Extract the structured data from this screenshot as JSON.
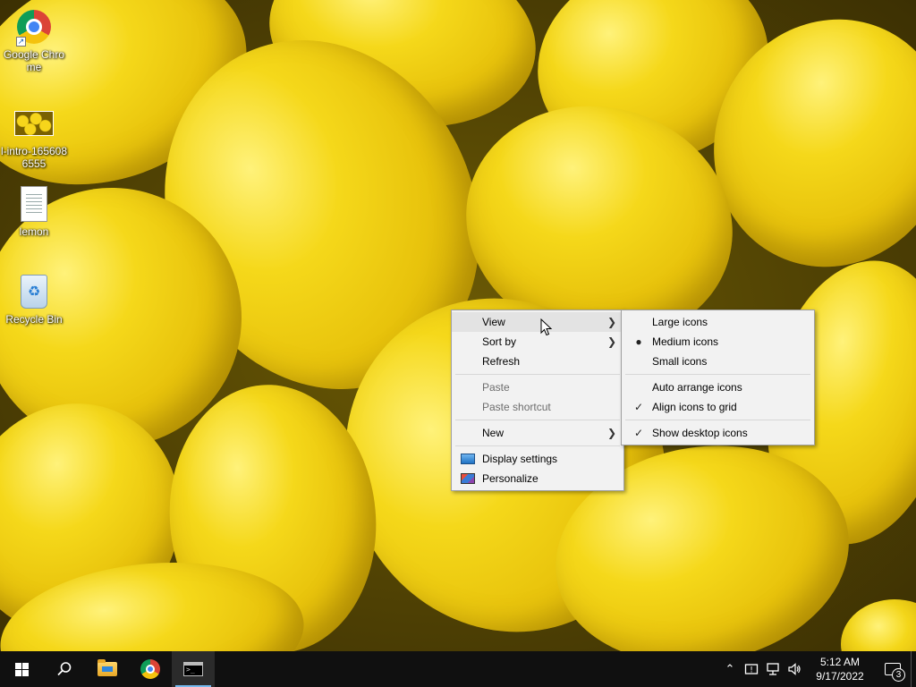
{
  "desktop": {
    "icons": [
      {
        "label": "Google Chrome",
        "icon": "chrome-icon"
      },
      {
        "label": "l-intro-1656086555",
        "icon": "image-thumbnail-icon"
      },
      {
        "label": "lemon",
        "icon": "text-document-icon"
      },
      {
        "label": "Recycle Bin",
        "icon": "recycle-bin-icon"
      }
    ]
  },
  "context_menu": {
    "items": {
      "view": "View",
      "sort_by": "Sort by",
      "refresh": "Refresh",
      "paste": "Paste",
      "paste_shortcut": "Paste shortcut",
      "new": "New",
      "display_settings": "Display settings",
      "personalize": "Personalize"
    },
    "hovered": "View"
  },
  "view_submenu": {
    "items": {
      "large_icons": "Large icons",
      "medium_icons": "Medium icons",
      "small_icons": "Small icons",
      "auto_arrange": "Auto arrange icons",
      "align_to_grid": "Align icons to grid",
      "show_desktop_icons": "Show desktop icons"
    },
    "selected_size": "Medium icons",
    "checked": [
      "Align icons to grid",
      "Show desktop icons"
    ]
  },
  "taskbar": {
    "pinned": [
      "start-icon",
      "search-icon",
      "file-explorer-icon",
      "chrome-icon",
      "command-prompt-icon"
    ],
    "active": "command-prompt-icon",
    "tray": {
      "time": "5:12 AM",
      "date": "9/17/2022",
      "notification_count": "3"
    }
  },
  "colors": {
    "taskbar_bg": "#101010",
    "menu_bg": "#f2f2f2",
    "accent": "#76b9ed"
  }
}
